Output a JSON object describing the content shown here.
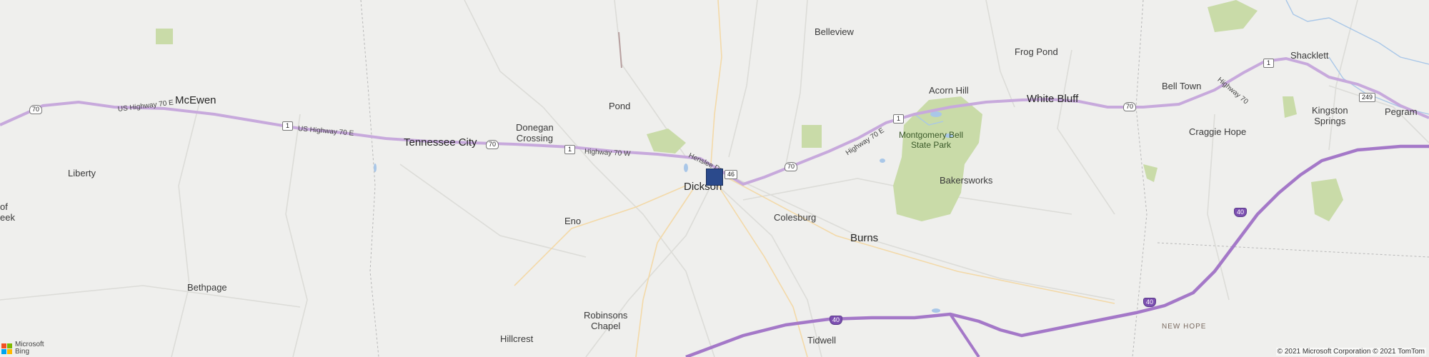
{
  "map": {
    "pin_color": "#2b4a8c",
    "park_color": "#c9dba8",
    "highway_color": "#c7a9dc",
    "interstate_color": "#a478c8",
    "background_color": "#efefed",
    "water_color": "#a9c7e8"
  },
  "places": {
    "mcewen": "McEwen",
    "liberty": "Liberty",
    "of": "of",
    "eek": "eek",
    "bethpage": "Bethpage",
    "tennessee_city": "Tennessee City",
    "donegan_crossing": "Donegan\nCrossing",
    "pond": "Pond",
    "eno": "Eno",
    "robinsons_chapel": "Robinsons\nChapel",
    "hillcrest": "Hillcrest",
    "dickson": "Dickson",
    "colesburg": "Colesburg",
    "burns": "Burns",
    "tidwell": "Tidwell",
    "belleview": "Belleview",
    "frog_pond": "Frog Pond",
    "acorn_hill": "Acorn Hill",
    "white_bluff": "White Bluff",
    "montgomery_bell": "Montgomery Bell\nState Park",
    "bakersworks": "Bakersworks",
    "bell_town": "Bell Town",
    "shacklett": "Shacklett",
    "craggie_hope": "Craggie Hope",
    "kingston_springs": "Kingston\nSprings",
    "pegram": "Pegram",
    "new_hope": "NEW HOPE"
  },
  "roads": {
    "us70e_west": "US Highway 70 E",
    "us70e_mid": "US Highway 70 E",
    "hwy70w": "Highway 70 W",
    "henslee": "Henslee Dr",
    "hwy70e_east": "Highway 70 E",
    "hwy70_far": "Highway 70"
  },
  "shields": {
    "s70_a": "70",
    "s1_a": "1",
    "s70_b": "70",
    "s1_b": "1",
    "s46": "46",
    "s70_c": "70",
    "s1_c": "1",
    "s70_d": "70",
    "s1_d": "1",
    "s249": "249",
    "i40_a": "40",
    "i40_b": "40",
    "i40_c": "40"
  },
  "attribution": {
    "logo_line1": "Microsoft",
    "logo_line2": "Bing",
    "copyright": "© 2021 Microsoft Corporation © 2021 TomTom"
  }
}
